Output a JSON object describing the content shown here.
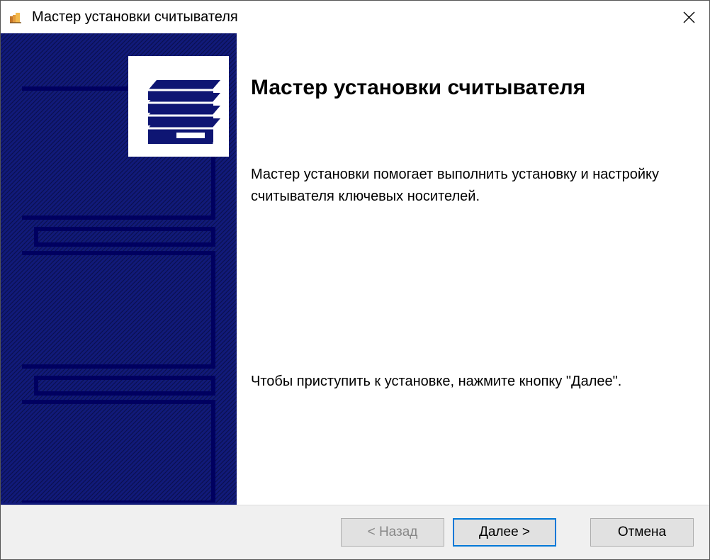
{
  "titlebar": {
    "title": "Мастер установки считывателя"
  },
  "main": {
    "heading": "Мастер установки считывателя",
    "description": "Мастер установки помогает выполнить установку и настройку считывателя ключевых носителей.",
    "hint": "Чтобы приступить к установке, нажмите кнопку \"Далее\"."
  },
  "footer": {
    "back": "< Назад",
    "next": "Далее >",
    "cancel": "Отмена"
  }
}
